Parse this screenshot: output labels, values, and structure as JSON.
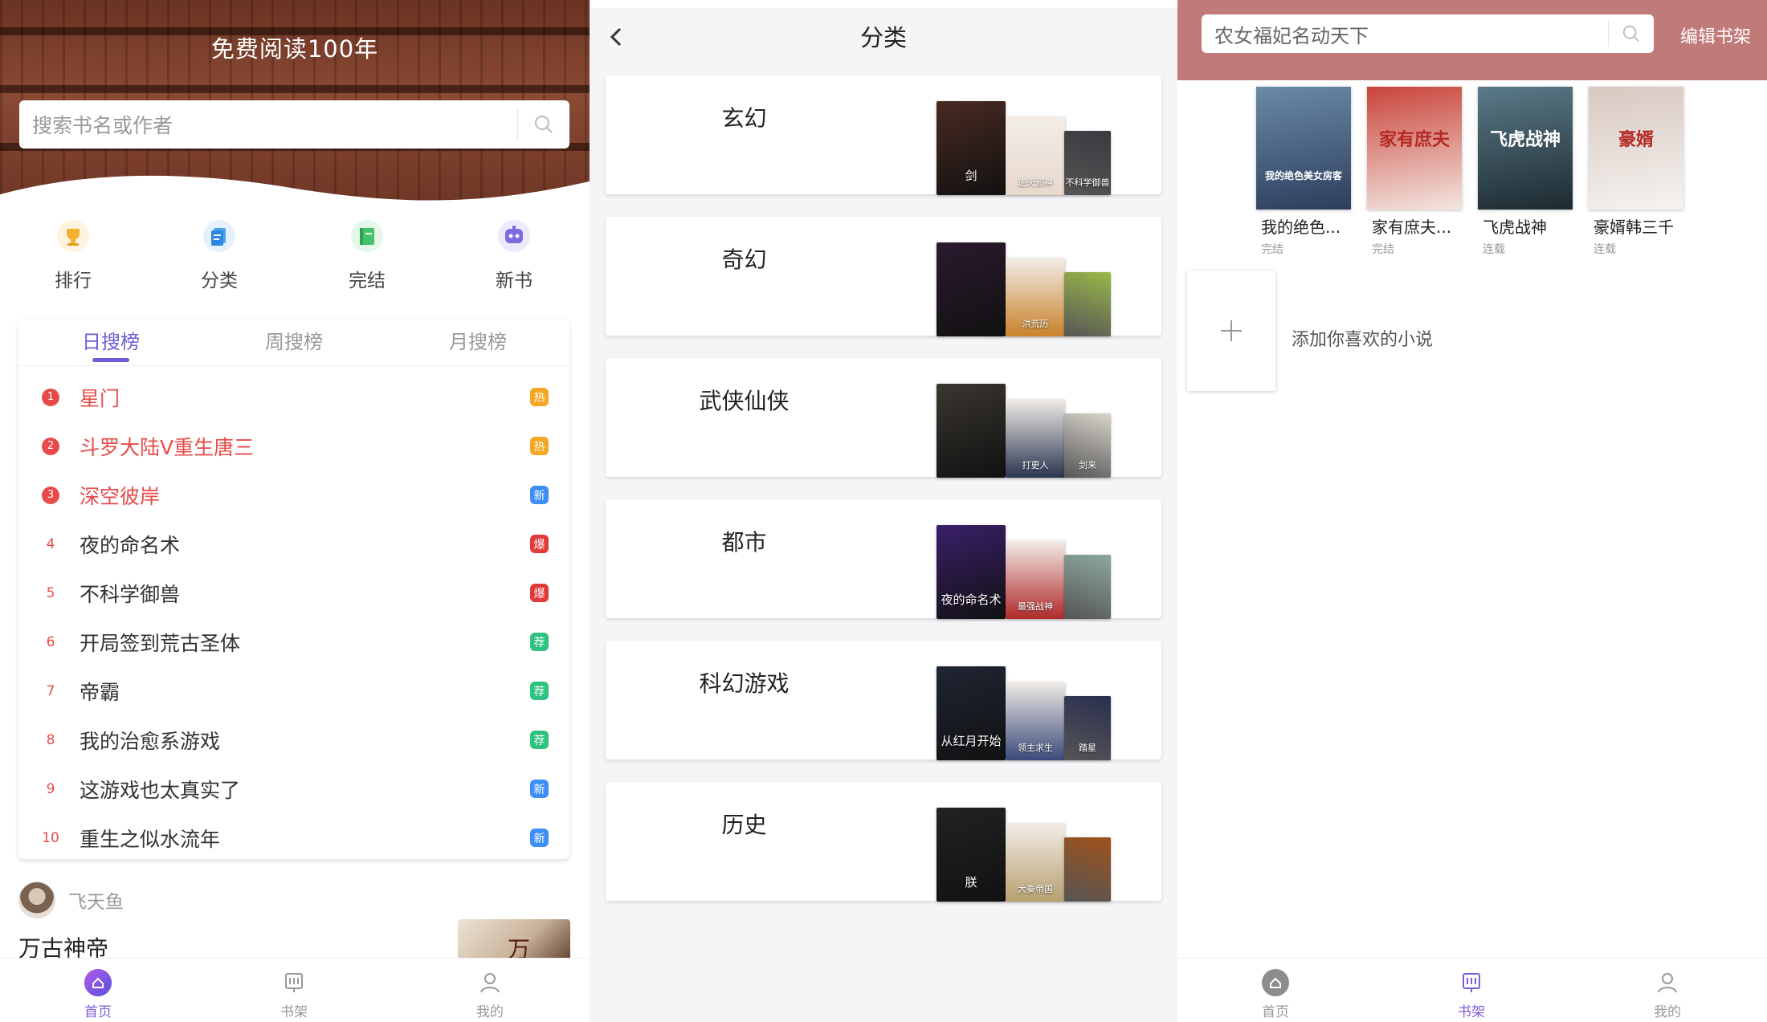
{
  "home": {
    "hero_title": "免费阅读100年",
    "search_placeholder": "搜索书名或作者",
    "quick_links": [
      {
        "label": "排行",
        "icon": "trophy-icon"
      },
      {
        "label": "分类",
        "icon": "category-icon"
      },
      {
        "label": "完结",
        "icon": "finished-book-icon"
      },
      {
        "label": "新书",
        "icon": "new-book-icon"
      }
    ],
    "rank_tabs": [
      "日搜榜",
      "周搜榜",
      "月搜榜"
    ],
    "active_tab": "日搜榜",
    "rankings": [
      {
        "rank": "1",
        "title": "星门",
        "badge": "热"
      },
      {
        "rank": "2",
        "title": "斗罗大陆V重生唐三",
        "badge": "热"
      },
      {
        "rank": "3",
        "title": "深空彼岸",
        "badge": "新"
      },
      {
        "rank": "4",
        "title": "夜的命名术",
        "badge": "爆"
      },
      {
        "rank": "5",
        "title": "不科学御兽",
        "badge": "爆"
      },
      {
        "rank": "6",
        "title": "开局签到荒古圣体",
        "badge": "荐"
      },
      {
        "rank": "7",
        "title": "帝霸",
        "badge": "荐"
      },
      {
        "rank": "8",
        "title": "我的治愈系游戏",
        "badge": "荐"
      },
      {
        "rank": "9",
        "title": "这游戏也太真实了",
        "badge": "新"
      },
      {
        "rank": "10",
        "title": "重生之似水流年",
        "badge": "新"
      }
    ],
    "badge_colors": {
      "热": "#f5a623",
      "新": "#3d8ff5",
      "爆": "#e03a3a",
      "荐": "#2ec27e"
    },
    "author_name": "飞天鱼",
    "featured_title": "万古神帝",
    "featured_cover_text": "万",
    "bottom_nav": [
      {
        "label": "首页",
        "icon": "home-icon",
        "active": true
      },
      {
        "label": "书架",
        "icon": "bookshelf-icon",
        "active": false
      },
      {
        "label": "我的",
        "icon": "profile-icon",
        "active": false
      }
    ]
  },
  "category": {
    "title": "分类",
    "categories": [
      {
        "name": "玄幻",
        "cover_texts": [
          "剑",
          "逆天邪神",
          "不科学御兽"
        ],
        "colors": [
          "#4a2a22",
          "#e8d8cc",
          "#3a3a40"
        ]
      },
      {
        "name": "奇幻",
        "cover_texts": [
          "",
          "洪荒历",
          ""
        ],
        "colors": [
          "#2a1a2e",
          "#c9822a",
          "#9bb84a"
        ]
      },
      {
        "name": "武侠仙侠",
        "cover_texts": [
          "",
          "打更人",
          "剑来"
        ],
        "colors": [
          "#3a3630",
          "#2a3550",
          "#d9d4cc"
        ]
      },
      {
        "name": "都市",
        "cover_texts": [
          "夜的命名术",
          "最强战神",
          ""
        ],
        "colors": [
          "#3a1f6a",
          "#b02a2a",
          "#8ea8a0"
        ]
      },
      {
        "name": "科幻游戏",
        "cover_texts": [
          "从红月开始",
          "领主求生",
          "踏星"
        ],
        "colors": [
          "#1f2533",
          "#3a4a7a",
          "#2a2f50"
        ]
      },
      {
        "name": "历史",
        "cover_texts": [
          "朕",
          "大秦帝国",
          ""
        ],
        "colors": [
          "#222222",
          "#b8a070",
          "#a0521a"
        ]
      }
    ]
  },
  "shelf": {
    "search_value": "农女福妃名动天下",
    "edit_label": "编辑书架",
    "books": [
      {
        "title": "我的绝色...",
        "status": "完结",
        "cover_text": "我的绝色美女房客",
        "color_a": "#2c3e5c",
        "color_b": "#6a8aa8"
      },
      {
        "title": "家有庶夫...",
        "status": "完结",
        "cover_text": "家有庶夫",
        "color_a": "#f3e6e0",
        "color_b": "#c9443a"
      },
      {
        "title": "飞虎战神",
        "status": "连载",
        "cover_text": "飞虎战神",
        "color_a": "#1d2a30",
        "color_b": "#5a7a88"
      },
      {
        "title": "豪婿韩三千",
        "status": "连载",
        "cover_text": "豪婿",
        "color_a": "#f5f3f0",
        "color_b": "#d8c8c0"
      }
    ],
    "add_text": "添加你喜欢的小说",
    "bottom_nav": [
      {
        "label": "首页",
        "icon": "home-icon",
        "active": false
      },
      {
        "label": "书架",
        "icon": "bookshelf-icon",
        "active": true
      },
      {
        "label": "我的",
        "icon": "profile-icon",
        "active": false
      }
    ]
  }
}
